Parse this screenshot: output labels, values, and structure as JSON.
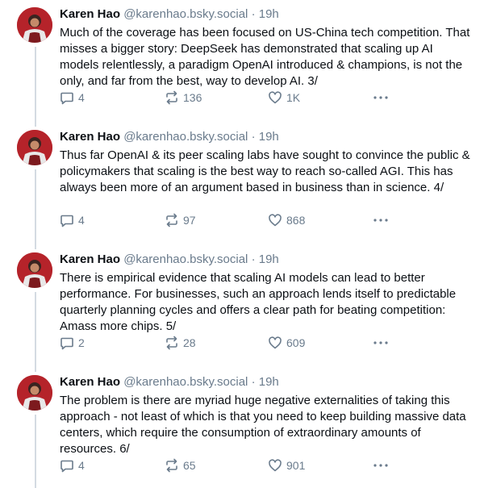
{
  "posts": [
    {
      "author": "Karen Hao",
      "handle": "@karenhao.bsky.social",
      "separator": "·",
      "time": "19h",
      "text": "Much of the coverage has been focused on US-China tech competition. That misses a bigger story: DeepSeek has demonstrated that scaling up AI models relentlessly, a paradigm OpenAI introduced & champions, is not the only, and far from the best, way to develop AI. 3/",
      "replies": "4",
      "reposts": "136",
      "likes": "1K"
    },
    {
      "author": "Karen Hao",
      "handle": "@karenhao.bsky.social",
      "separator": "·",
      "time": "19h",
      "text": "Thus far OpenAI & its peer scaling labs have sought to convince the public & policymakers that scaling is the best way to reach so-called AGI. This has always been more of an argument based in business than in science. 4/",
      "replies": "4",
      "reposts": "97",
      "likes": "868"
    },
    {
      "author": "Karen Hao",
      "handle": "@karenhao.bsky.social",
      "separator": "·",
      "time": "19h",
      "text": "There is empirical evidence that scaling AI models can lead to better performance. For businesses, such an approach lends itself to predictable quarterly planning cycles and offers a clear path for beating competition: Amass more chips. 5/",
      "replies": "2",
      "reposts": "28",
      "likes": "609"
    },
    {
      "author": "Karen Hao",
      "handle": "@karenhao.bsky.social",
      "separator": "·",
      "time": "19h",
      "text": "The problem is there are myriad huge negative externalities of taking this approach - not least of which is that you need to keep building massive data centers, which require the consumption of extraordinary amounts of resources. 6/",
      "replies": "4",
      "reposts": "65",
      "likes": "901"
    }
  ],
  "icons": {
    "reply": "reply-bubble-icon",
    "repost": "repost-arrows-icon",
    "like": "heart-icon",
    "more": "more-dots-icon"
  },
  "colors": {
    "text": "#0b0f14",
    "muted": "#6a7b8c",
    "thread_line": "#d4dbe2",
    "avatar_bg": "#b5232a"
  }
}
